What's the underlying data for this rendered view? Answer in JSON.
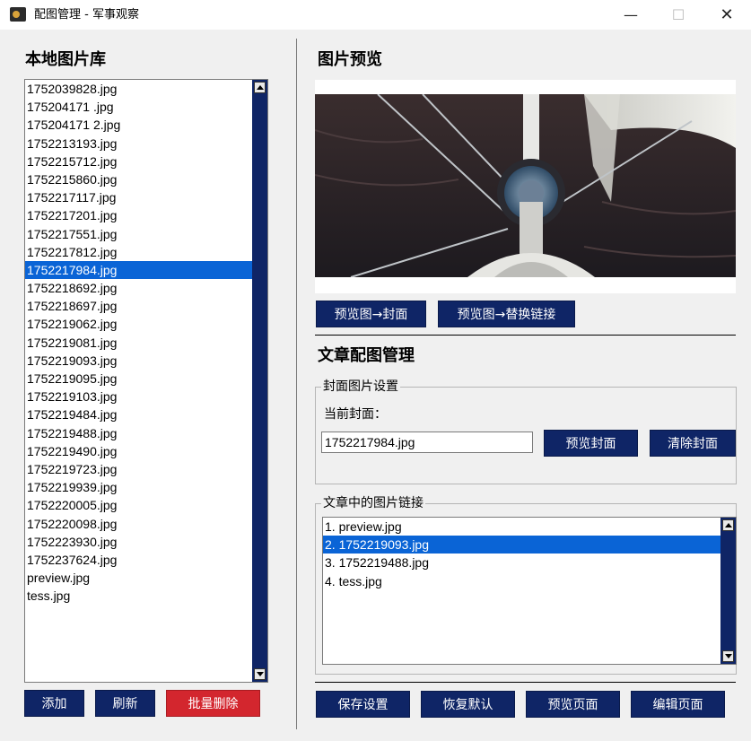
{
  "window": {
    "title": "配图管理 - 军事观察",
    "minimize": "—",
    "maximize": "☐",
    "close": "✕"
  },
  "local_library": {
    "heading": "本地图片库",
    "items": [
      "1752039828.jpg",
      "175204171 .jpg",
      "175204171 2.jpg",
      "1752213193.jpg",
      "1752215712.jpg",
      "1752215860.jpg",
      "1752217117.jpg",
      "1752217201.jpg",
      "1752217551.jpg",
      "1752217812.jpg",
      "1752217984.jpg",
      "1752218692.jpg",
      "1752218697.jpg",
      "1752219062.jpg",
      "1752219081.jpg",
      "1752219093.jpg",
      "1752219095.jpg",
      "1752219103.jpg",
      "1752219484.jpg",
      "1752219488.jpg",
      "1752219490.jpg",
      "1752219723.jpg",
      "1752219939.jpg",
      "1752220005.jpg",
      "1752220098.jpg",
      "1752223930.jpg",
      "1752237624.jpg",
      "preview.jpg",
      "tess.jpg"
    ],
    "selected_index": 10,
    "buttons": {
      "add": "添加",
      "refresh": "刷新",
      "batch_delete": "批量删除"
    }
  },
  "preview": {
    "heading": "图片预览",
    "buttons": {
      "to_cover": "预览图→封面",
      "to_replace": "预览图→替换链接"
    }
  },
  "article": {
    "heading": "文章配图管理",
    "cover_group": {
      "label": "封面图片设置",
      "current_label": "当前封面：",
      "current_value": "1752217984.jpg",
      "preview_cover": "预览封面",
      "clear_cover": "清除封面"
    },
    "links_group": {
      "label": "文章中的图片链接",
      "items": [
        "1. preview.jpg",
        "2. 1752219093.jpg",
        "3. 1752219488.jpg",
        "4. tess.jpg"
      ],
      "selected_index": 1
    },
    "buttons": {
      "save": "保存设置",
      "restore": "恢复默认",
      "preview_page": "预览页面",
      "edit_page": "编辑页面"
    }
  },
  "colors": {
    "button_navy": "#0f2566",
    "button_red": "#d3262e",
    "selection_blue": "#0a64d6"
  }
}
